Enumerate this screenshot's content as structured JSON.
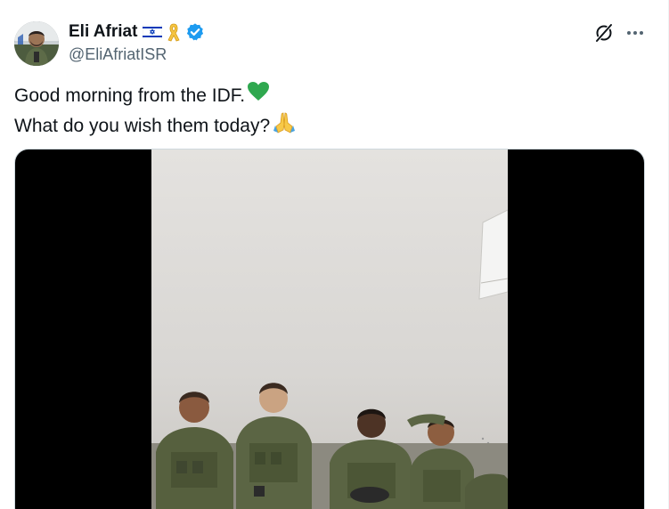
{
  "author": {
    "display_name": "Eli Afriat",
    "handle": "@EliAfriatISR",
    "badges": [
      "israel-flag-icon",
      "yellow-ribbon-icon",
      "verified-badge-icon"
    ]
  },
  "post": {
    "line1": "Good morning from the IDF.",
    "line1_emoji": "green-heart-icon",
    "line2": "What do you wish them today?",
    "line2_emoji": "folded-hands-icon"
  },
  "media": {
    "type": "video"
  },
  "actions": [
    "grok-icon",
    "more-icon"
  ],
  "colors": {
    "text": "#0f1419",
    "secondary": "#536471",
    "verified": "#1d9bf0",
    "flag_blue": "#0038b8",
    "ribbon": "#f5c542",
    "heart": "#2fa84f"
  }
}
